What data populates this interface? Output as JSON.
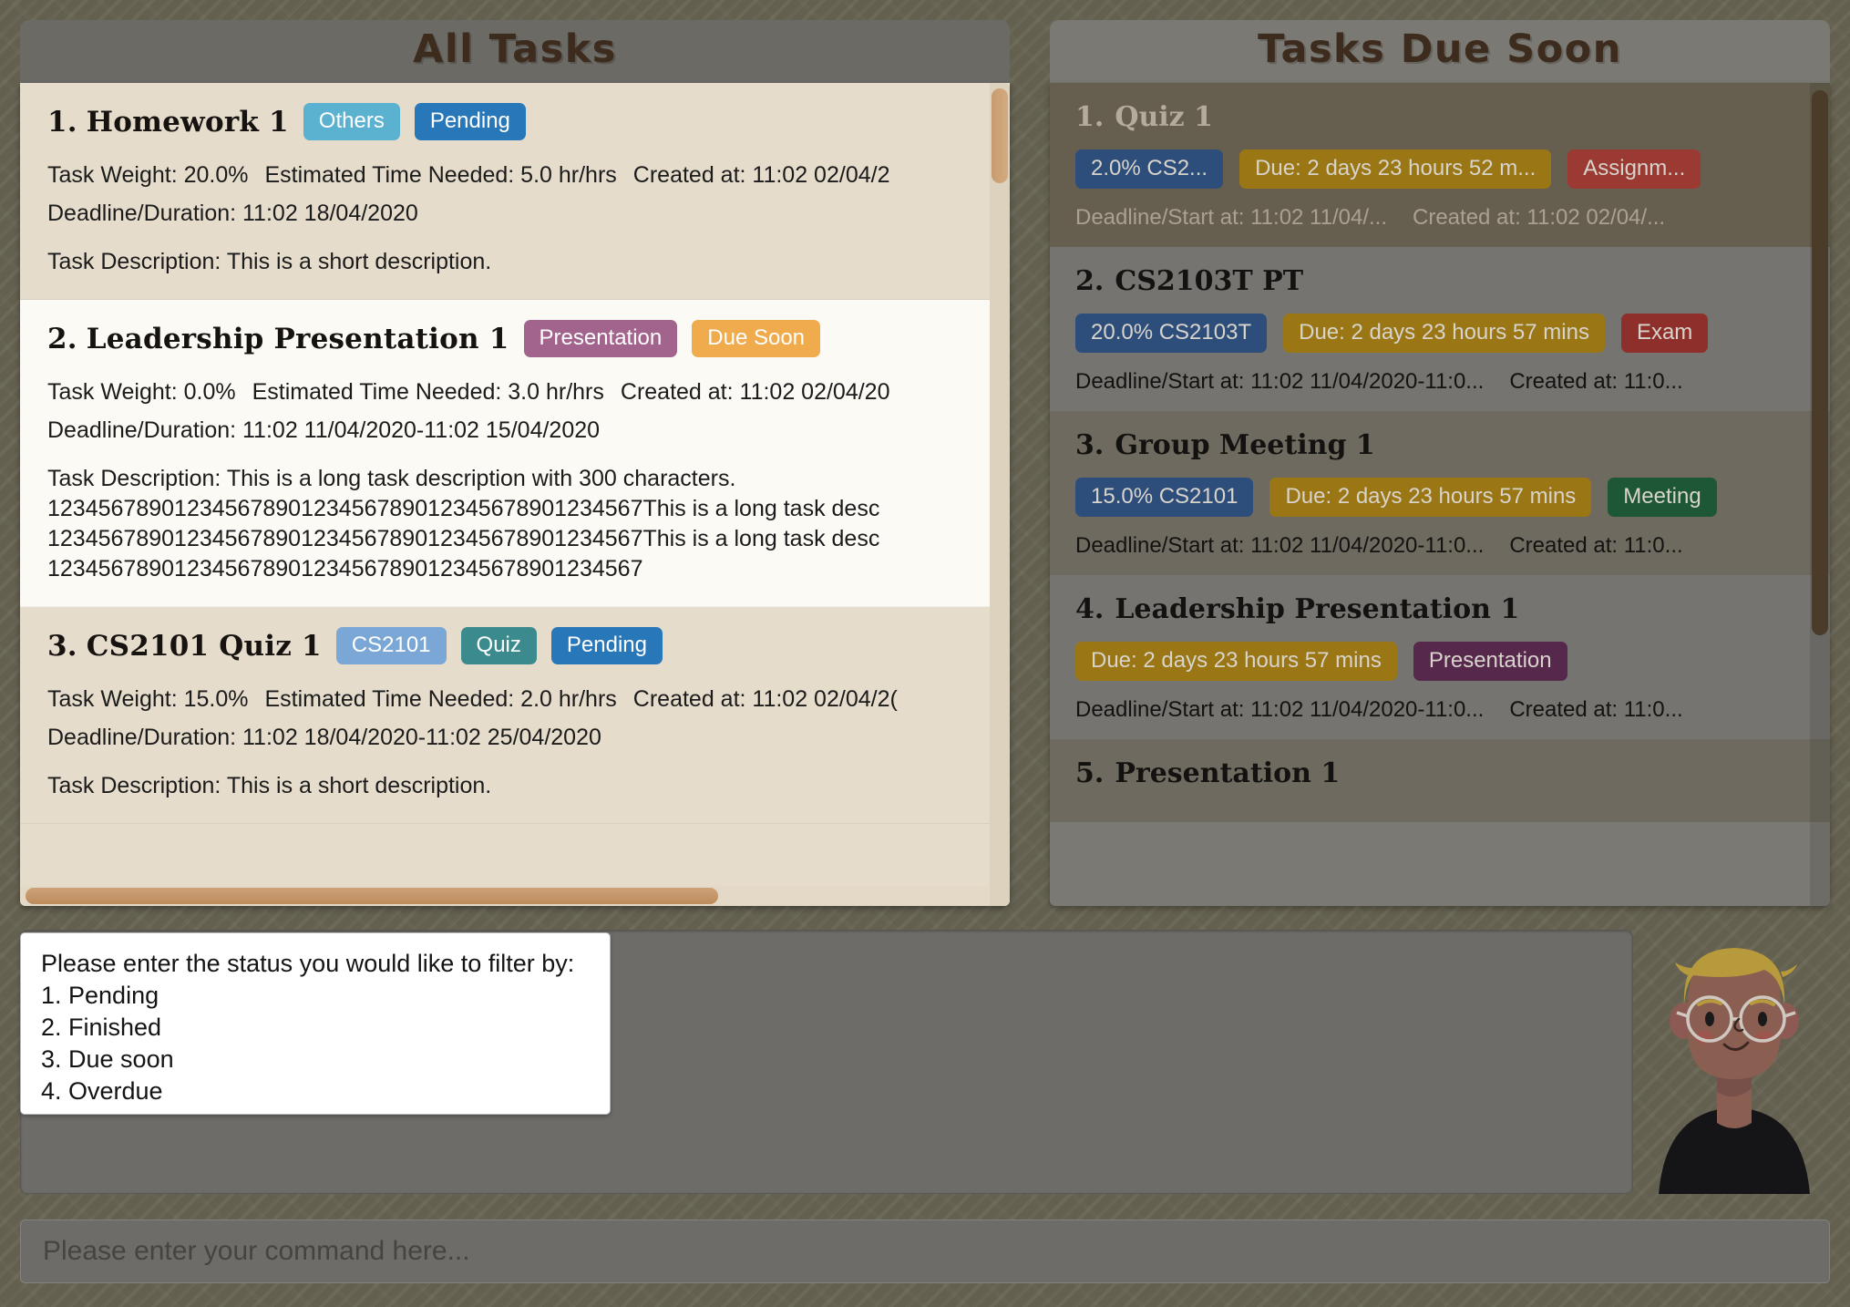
{
  "all_tasks": {
    "header_title": "All Tasks",
    "tasks": [
      {
        "index": "1.",
        "title": "Homework 1",
        "chips": [
          {
            "label": "Others",
            "color": "#5bb1d0"
          },
          {
            "label": "Pending",
            "color": "#2877b8"
          }
        ],
        "weight_label": "Task Weight: 20.0%",
        "time_label": "Estimated Time Needed: 5.0 hr/hrs",
        "created_label": "Created at: 11:02 02/04/2",
        "deadline_label": "Deadline/Duration: 11:02 18/04/2020",
        "description_label": "Task Description: This is a short description."
      },
      {
        "index": "2.",
        "title": "Leadership Presentation 1",
        "chips": [
          {
            "label": "Presentation",
            "color": "#a2648d"
          },
          {
            "label": "Due Soon",
            "color": "#efab4c"
          }
        ],
        "weight_label": "Task Weight: 0.0%",
        "time_label": "Estimated Time Needed: 3.0 hr/hrs",
        "created_label": "Created at: 11:02 02/04/20",
        "deadline_label": "Deadline/Duration: 11:02 11/04/2020-11:02 15/04/2020",
        "description_label": "Task Description: This is a long task description with 300 characters.\n12345678901234567890123456789012345678901234567This is a long task desc\n12345678901234567890123456789012345678901234567This is a long task desc\n12345678901234567890123456789012345678901234567"
      },
      {
        "index": "3.",
        "title": "CS2101 Quiz 1",
        "chips": [
          {
            "label": "CS2101",
            "color": "#7ba7d7"
          },
          {
            "label": "Quiz",
            "color": "#3b8a8e"
          },
          {
            "label": "Pending",
            "color": "#2877b8"
          }
        ],
        "weight_label": "Task Weight: 15.0%",
        "time_label": "Estimated Time Needed: 2.0 hr/hrs",
        "created_label": "Created at: 11:02 02/04/2(",
        "deadline_label": "Deadline/Duration: 11:02 18/04/2020-11:02 25/04/2020",
        "description_label": "Task Description: This is a short description."
      }
    ]
  },
  "due_soon": {
    "header_title": "Tasks Due Soon",
    "tasks": [
      {
        "index": "1.",
        "title": "Quiz 1",
        "chips": [
          {
            "label": "2.0% CS2...",
            "color": "#2d4d7a"
          },
          {
            "label": "Due: 2 days 23 hours 52 m...",
            "color": "#9a7614"
          },
          {
            "label": "Assignm...",
            "color": "#9a3a33"
          }
        ],
        "deadline_label": "Deadline/Start at: 11:02 11/04/...",
        "created_label": "Created at: 11:02 02/04/..."
      },
      {
        "index": "2.",
        "title": "CS2103T PT",
        "chips": [
          {
            "label": "20.0% CS2103T",
            "color": "#2d4d7a"
          },
          {
            "label": "Due: 2 days 23 hours 57 mins",
            "color": "#9a7614"
          },
          {
            "label": "Exam",
            "color": "#8e2f2c"
          }
        ],
        "deadline_label": "Deadline/Start at: 11:02 11/04/2020-11:0...",
        "created_label": "Created at: 11:0..."
      },
      {
        "index": "3.",
        "title": "Group Meeting 1",
        "chips": [
          {
            "label": "15.0% CS2101",
            "color": "#2d4d7a"
          },
          {
            "label": "Due: 2 days 23 hours 57 mins",
            "color": "#9a7614"
          },
          {
            "label": "Meeting",
            "color": "#1d5736"
          }
        ],
        "deadline_label": "Deadline/Start at: 11:02 11/04/2020-11:0...",
        "created_label": "Created at: 11:0..."
      },
      {
        "index": "4.",
        "title": "Leadership Presentation 1",
        "chips": [
          {
            "label": "Due: 2 days 23 hours 57 mins",
            "color": "#9a7614"
          },
          {
            "label": "Presentation",
            "color": "#56284c"
          }
        ],
        "deadline_label": "Deadline/Start at: 11:02 11/04/2020-11:0...",
        "created_label": "Created at: 11:0..."
      },
      {
        "index": "5.",
        "title": "Presentation 1",
        "chips": [],
        "deadline_label": "",
        "created_label": ""
      }
    ]
  },
  "filter_dialog": {
    "prompt": "Please enter the status you would like to filter by:",
    "options": [
      "1. Pending",
      "2. Finished",
      "3. Due soon",
      "4. Overdue"
    ]
  },
  "command_bar": {
    "placeholder": "Please enter your command here...",
    "value": ""
  },
  "avatar": {
    "name": "user-avatar",
    "hair_color": "#b79a3c",
    "skin_color": "#8a5f52",
    "shirt_color": "#151518"
  },
  "theme": {
    "background": "#63604f",
    "panel_header": "#6c6a65",
    "left_list_bg": "#e5dccb",
    "right_list_bg": "#7a7973",
    "title_color": "#3d2b1d"
  }
}
